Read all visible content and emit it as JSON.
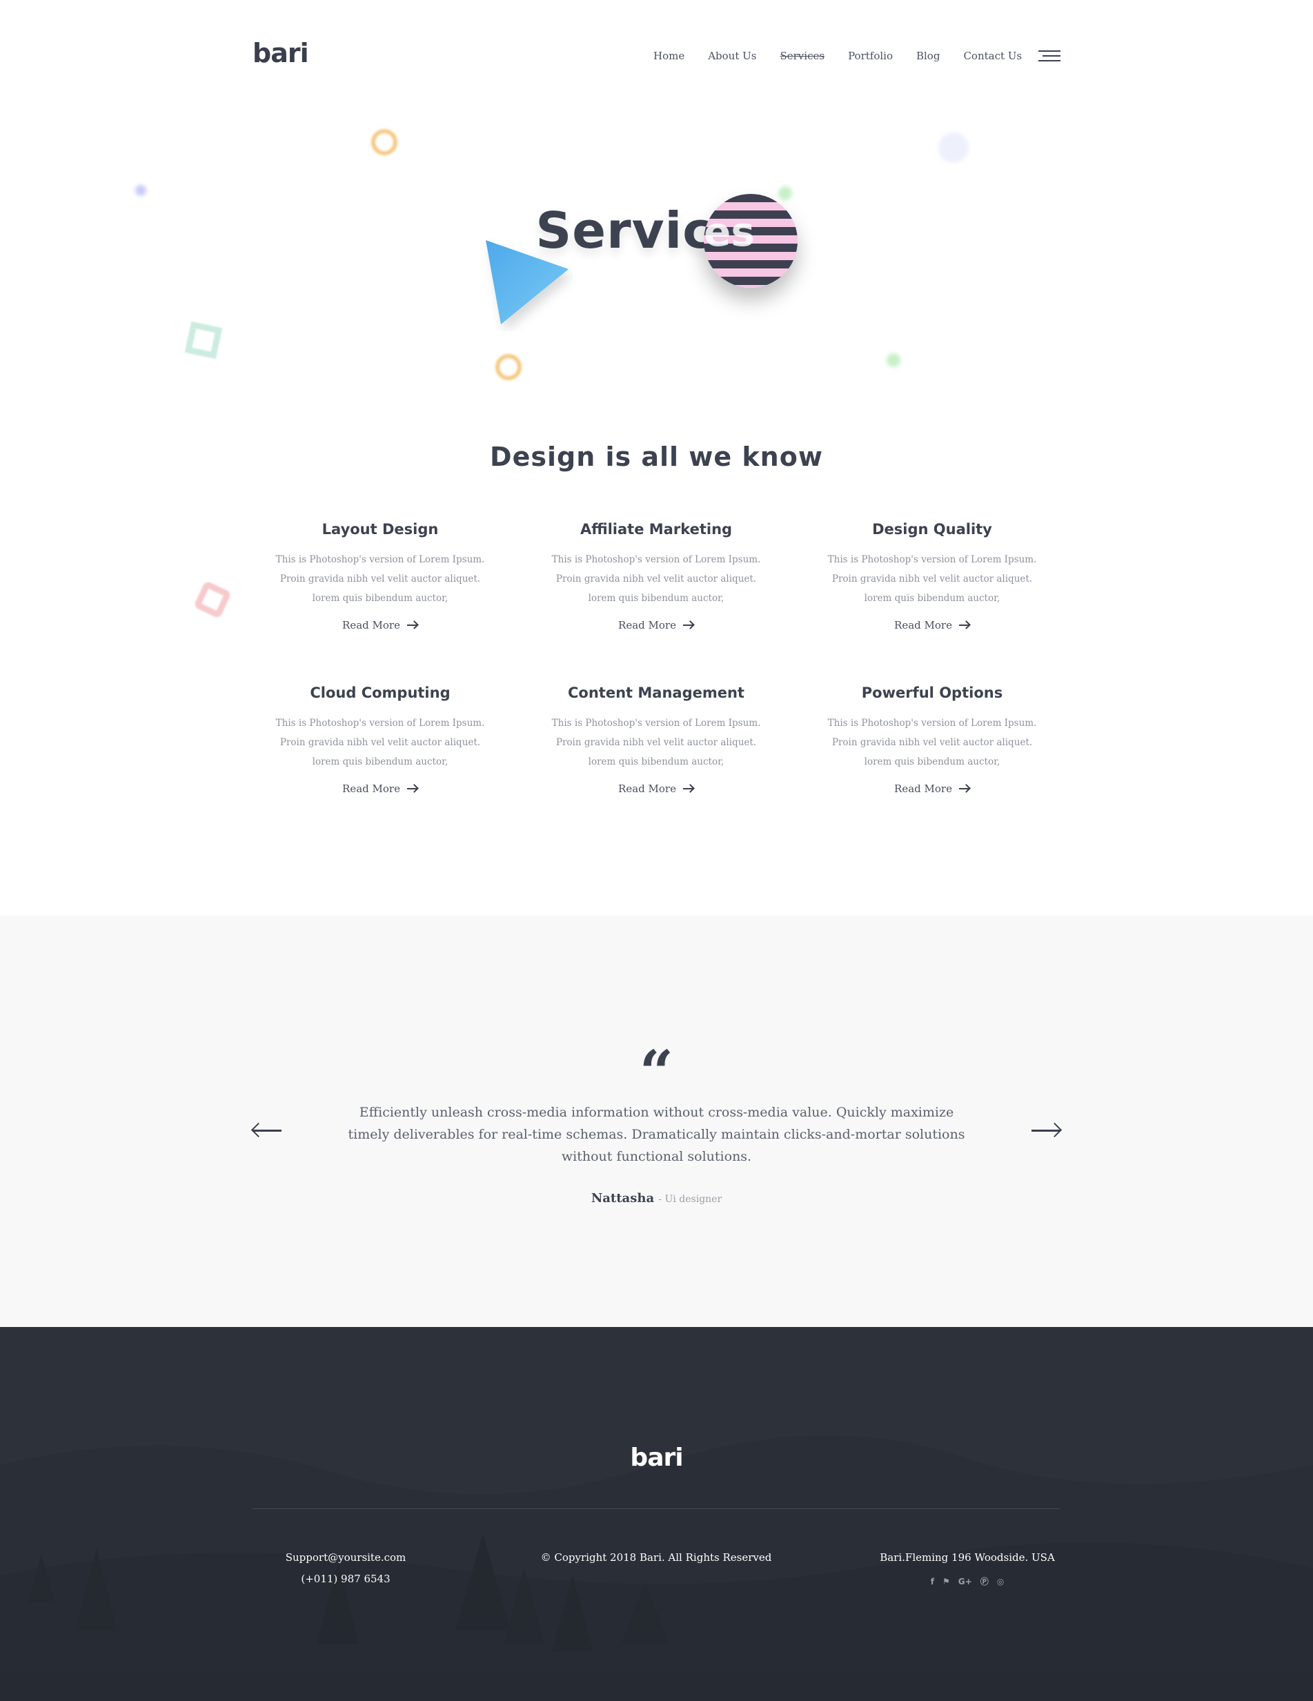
{
  "header": {
    "logo": "bari",
    "nav": [
      "Home",
      "About Us",
      "Services",
      "Portfolio",
      "Blog",
      "Contact Us"
    ],
    "active_nav": "Services"
  },
  "hero": {
    "title": "Services",
    "circle_overlay_text": "es",
    "colors": {
      "triangle": "#5ab7ef",
      "stripe_dark": "#3d4050",
      "stripe_pink": "#f7c7e4",
      "ring": "#f5c06e"
    }
  },
  "services": {
    "heading": "Design is all we know",
    "items": [
      {
        "title": "Layout Design",
        "desc": "This is Photoshop's version of Lorem Ipsum.\nProin gravida nibh vel velit auctor aliquet.\nlorem quis bibendum auctor,",
        "link": "Read More"
      },
      {
        "title": "Affiliate Marketing",
        "desc": "This is Photoshop's version of Lorem Ipsum.\nProin gravida nibh vel velit auctor aliquet.\nlorem quis bibendum auctor,",
        "link": "Read More"
      },
      {
        "title": "Design Quality",
        "desc": "This is Photoshop's version of Lorem Ipsum.\nProin gravida nibh vel velit auctor aliquet.\nlorem quis bibendum auctor,",
        "link": "Read More"
      },
      {
        "title": "Cloud Computing",
        "desc": "This is Photoshop's version of Lorem Ipsum.\nProin gravida nibh vel velit auctor aliquet.\nlorem quis bibendum auctor,",
        "link": "Read More"
      },
      {
        "title": "Content Management",
        "desc": "This is Photoshop's version of Lorem Ipsum.\nProin gravida nibh vel velit auctor aliquet.\nlorem quis bibendum auctor,",
        "link": "Read More"
      },
      {
        "title": "Powerful Options",
        "desc": "This is Photoshop's version of Lorem Ipsum.\nProin gravida nibh vel velit auctor aliquet.\nlorem quis bibendum auctor,",
        "link": "Read More"
      }
    ]
  },
  "testimonial": {
    "quote_mark": "“",
    "text": "Efficiently unleash cross-media information without cross-media value. Quickly maximize timely deliverables for real-time schemas. Dramatically maintain clicks-and-mortar solutions without functional solutions.",
    "author": "Nattasha",
    "role": "- Ui designer",
    "prev_icon": "arrow-left-icon",
    "next_icon": "arrow-right-icon"
  },
  "footer": {
    "logo": "bari",
    "email": "Support@yoursite.com",
    "phone": "(+011) 987 6543",
    "copyright": "© Copyright 2018 Bari. All Rights Reserved",
    "address": "Bari.Fleming 196 Woodside. USA",
    "social": [
      {
        "icon": "facebook-icon",
        "glyph": "f"
      },
      {
        "icon": "twitter-icon",
        "glyph": "⚑"
      },
      {
        "icon": "google-plus-icon",
        "glyph": "G+"
      },
      {
        "icon": "pinterest-icon",
        "glyph": "Ⓟ"
      },
      {
        "icon": "dribbble-icon",
        "glyph": "◎"
      }
    ]
  }
}
